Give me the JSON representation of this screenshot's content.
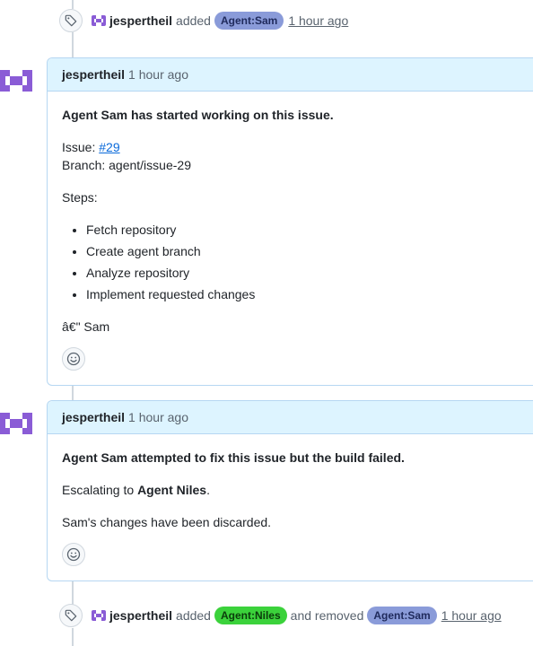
{
  "colors": {
    "agent_sam_label_bg": "#8a9bd9",
    "agent_sam_label_fg": "#1f2a5c",
    "agent_niles_label_bg": "#3bd23b",
    "agent_niles_label_fg": "#0b3d0b",
    "avatar_purple": "#8a5cd6",
    "header_bg": "#ddf4ff",
    "link": "#0969da"
  },
  "event1": {
    "icon": "tag-icon",
    "actor": "jespertheil",
    "verb": "added",
    "label": "Agent:Sam",
    "time": "1 hour ago"
  },
  "comment1": {
    "author": "jespertheil",
    "time": "1 hour ago",
    "title": "Agent Sam has started working on this issue.",
    "issue_prefix": "Issue:",
    "issue_link": "#29",
    "branch": "Branch: agent/issue-29",
    "steps_title": "Steps:",
    "steps": [
      "Fetch repository",
      "Create agent branch",
      "Analyze repository",
      "Implement requested changes"
    ],
    "signature": "â€\" Sam",
    "reaction_icon": "smiley-icon"
  },
  "comment2": {
    "author": "jespertheil",
    "time": "1 hour ago",
    "title": "Agent Sam attempted to fix this issue but the build failed.",
    "escalate_prefix": "Escalating to",
    "escalate_target": "Agent Niles",
    "escalate_suffix": ".",
    "discarded": "Sam's changes have been discarded.",
    "reaction_icon": "smiley-icon"
  },
  "event2": {
    "icon": "tag-icon",
    "actor": "jespertheil",
    "verb": "added",
    "added_label": "Agent:Niles",
    "middle": "and removed",
    "removed_label": "Agent:Sam",
    "time": "1 hour ago"
  }
}
